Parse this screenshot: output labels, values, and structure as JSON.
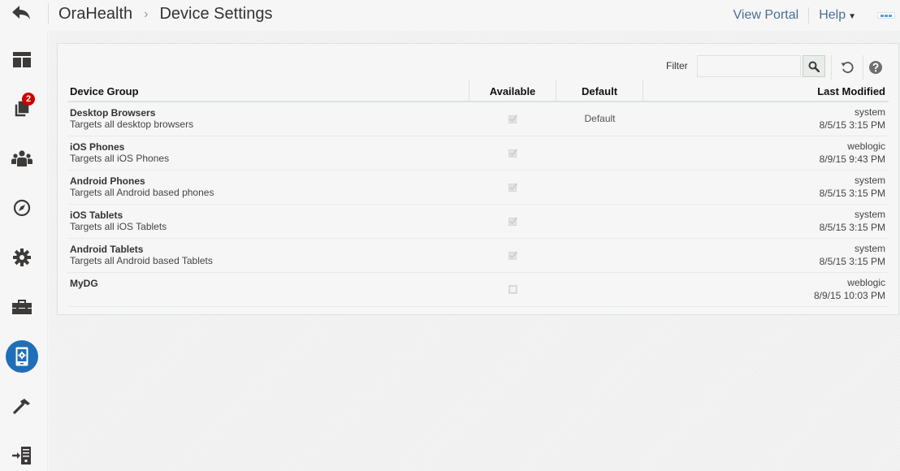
{
  "header": {
    "app": "OraHealth",
    "separator": "›",
    "page_title": "Device Settings",
    "view_portal": "View Portal",
    "help": "Help",
    "help_caret": "▼"
  },
  "sidebar": {
    "items": [
      {
        "id": "layout",
        "icon": "layout-icon",
        "active": false
      },
      {
        "id": "pages",
        "icon": "pages-icon",
        "active": false,
        "badge": "2"
      },
      {
        "id": "users",
        "icon": "users-icon",
        "active": false
      },
      {
        "id": "navigation",
        "icon": "compass-icon",
        "active": false
      },
      {
        "id": "settings",
        "icon": "gear-icon",
        "active": false
      },
      {
        "id": "toolbox",
        "icon": "toolbox-icon",
        "active": false
      },
      {
        "id": "device-settings",
        "icon": "device-settings-icon",
        "active": true
      },
      {
        "id": "build",
        "icon": "hammer-icon",
        "active": false
      },
      {
        "id": "server",
        "icon": "server-import-icon",
        "active": false
      }
    ]
  },
  "toolbar": {
    "filter_label": "Filter",
    "filter_value": "",
    "filter_placeholder": ""
  },
  "table": {
    "columns": [
      "Device Group",
      "Available",
      "Default",
      "Last Modified"
    ],
    "rows": [
      {
        "name": "Desktop Browsers",
        "description": "Targets all desktop browsers",
        "available": true,
        "default": "Default",
        "modified_by": "system",
        "modified_at": "8/5/15 3:15 PM"
      },
      {
        "name": "iOS Phones",
        "description": "Targets all iOS Phones",
        "available": true,
        "default": "",
        "modified_by": "weblogic",
        "modified_at": "8/9/15 9:43 PM"
      },
      {
        "name": "Android Phones",
        "description": "Targets all Android based phones",
        "available": true,
        "default": "",
        "modified_by": "system",
        "modified_at": "8/5/15 3:15 PM"
      },
      {
        "name": "iOS Tablets",
        "description": "Targets all iOS Tablets",
        "available": true,
        "default": "",
        "modified_by": "system",
        "modified_at": "8/5/15 3:15 PM"
      },
      {
        "name": "Android Tablets",
        "description": "Targets all Android based Tablets",
        "available": true,
        "default": "",
        "modified_by": "system",
        "modified_at": "8/5/15 3:15 PM"
      },
      {
        "name": "MyDG",
        "description": "",
        "available": false,
        "default": "",
        "modified_by": "weblogic",
        "modified_at": "8/9/15 10:03 PM"
      }
    ]
  },
  "colors": {
    "accent": "#1f6fb8",
    "link": "#4a6f96",
    "badge": "#cc0000",
    "icon": "#3d3a3a"
  }
}
